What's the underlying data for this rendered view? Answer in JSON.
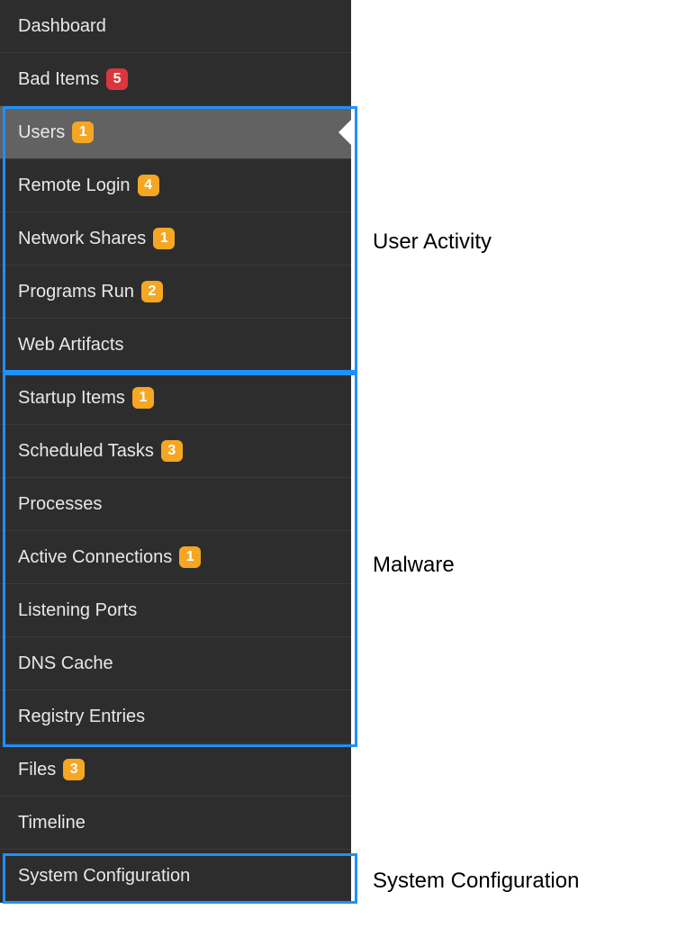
{
  "sidebar": {
    "items": [
      {
        "label": "Dashboard",
        "badge": null,
        "badgeColor": null,
        "selected": false
      },
      {
        "label": "Bad Items",
        "badge": "5",
        "badgeColor": "red",
        "selected": false
      },
      {
        "label": "Users",
        "badge": "1",
        "badgeColor": "orange",
        "selected": true
      },
      {
        "label": "Remote Login",
        "badge": "4",
        "badgeColor": "orange",
        "selected": false
      },
      {
        "label": "Network Shares",
        "badge": "1",
        "badgeColor": "orange",
        "selected": false
      },
      {
        "label": "Programs Run",
        "badge": "2",
        "badgeColor": "orange",
        "selected": false
      },
      {
        "label": "Web Artifacts",
        "badge": null,
        "badgeColor": null,
        "selected": false
      },
      {
        "label": "Startup Items",
        "badge": "1",
        "badgeColor": "orange",
        "selected": false
      },
      {
        "label": "Scheduled Tasks",
        "badge": "3",
        "badgeColor": "orange",
        "selected": false
      },
      {
        "label": "Processes",
        "badge": null,
        "badgeColor": null,
        "selected": false
      },
      {
        "label": "Active Connections",
        "badge": "1",
        "badgeColor": "orange",
        "selected": false
      },
      {
        "label": "Listening Ports",
        "badge": null,
        "badgeColor": null,
        "selected": false
      },
      {
        "label": "DNS Cache",
        "badge": null,
        "badgeColor": null,
        "selected": false
      },
      {
        "label": "Registry Entries",
        "badge": null,
        "badgeColor": null,
        "selected": false
      },
      {
        "label": "Files",
        "badge": "3",
        "badgeColor": "orange",
        "selected": false
      },
      {
        "label": "Timeline",
        "badge": null,
        "badgeColor": null,
        "selected": false
      },
      {
        "label": "System Configuration",
        "badge": null,
        "badgeColor": null,
        "selected": false
      }
    ]
  },
  "annotations": {
    "userActivity": "User Activity",
    "malware": "Malware",
    "systemConfiguration": "System Configuration"
  }
}
